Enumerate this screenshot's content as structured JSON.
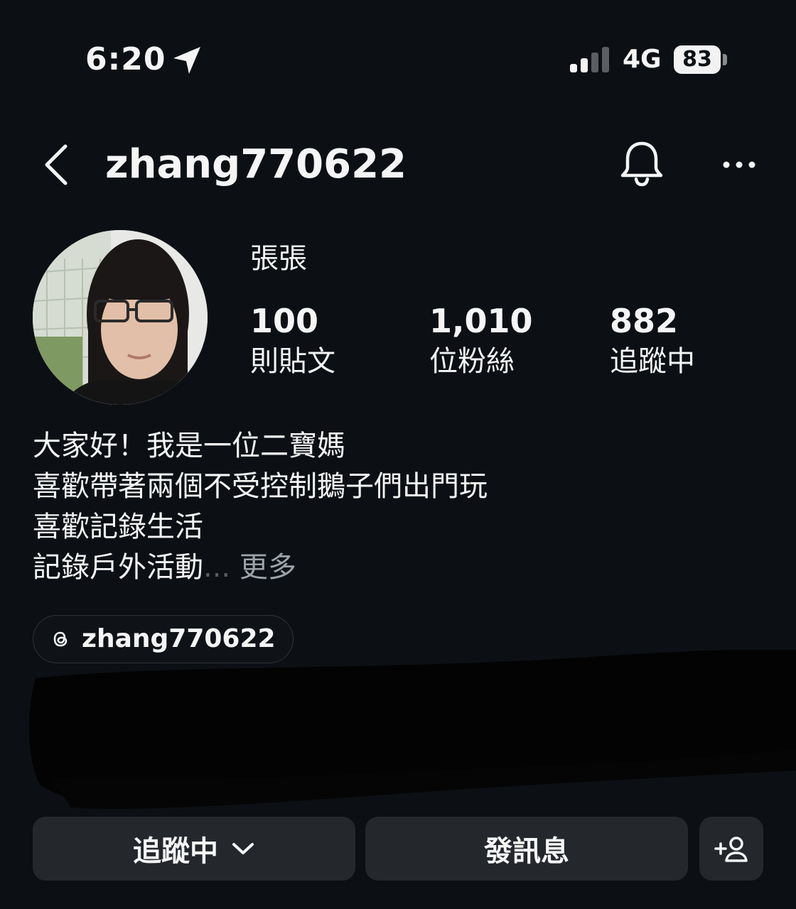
{
  "status_bar": {
    "time": "6:20",
    "network": "4G",
    "battery": "83",
    "icons": [
      "location-arrow-icon",
      "signal-bars-icon",
      "battery-icon"
    ]
  },
  "header": {
    "username": "zhang770622",
    "icons": [
      "back-chevron-icon",
      "bell-icon",
      "more-dots-icon"
    ]
  },
  "profile": {
    "display_name": "張張",
    "stats": [
      {
        "value": "100",
        "label": "則貼文"
      },
      {
        "value": "1,010",
        "label": "位粉絲"
      },
      {
        "value": "882",
        "label": "追蹤中"
      }
    ]
  },
  "bio": {
    "lines": [
      "大家好！我是一位二寶媽",
      "喜歡帶著兩個不受控制鵝子們出門玩",
      "喜歡記錄生活",
      "記錄戶外活動"
    ],
    "ellipsis": "...",
    "more_label": "更多"
  },
  "threads": {
    "handle": "zhang770622",
    "icon": "threads-icon"
  },
  "actions": {
    "following_label": "追蹤中",
    "message_label": "發訊息",
    "icons": [
      "chevron-down-icon",
      "add-person-icon"
    ]
  },
  "colors": {
    "background": "#0c1014",
    "text": "#f5f5f5",
    "button_bg": "#24282d",
    "muted": "#9ea3a9"
  }
}
